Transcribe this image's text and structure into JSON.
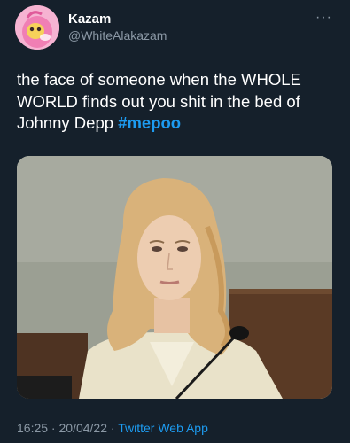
{
  "user": {
    "name": "Kazam",
    "handle": "@WhiteAlakazam"
  },
  "tweet": {
    "text": "the face of someone when the WHOLE WORLD finds out you shit in the bed of Johnny Depp ",
    "hashtag": "#mepoo"
  },
  "meta": {
    "time": "16:25",
    "sep1": " · ",
    "date": "20/04/22",
    "sep2": " · ",
    "source": "Twitter Web App"
  },
  "icons": {
    "more": "more-options-icon",
    "avatar": "pink-cartoon-avatar"
  },
  "colors": {
    "background": "#15202b",
    "text": "#ffffff",
    "secondary": "#8b98a5",
    "accent": "#1d9bf0"
  }
}
